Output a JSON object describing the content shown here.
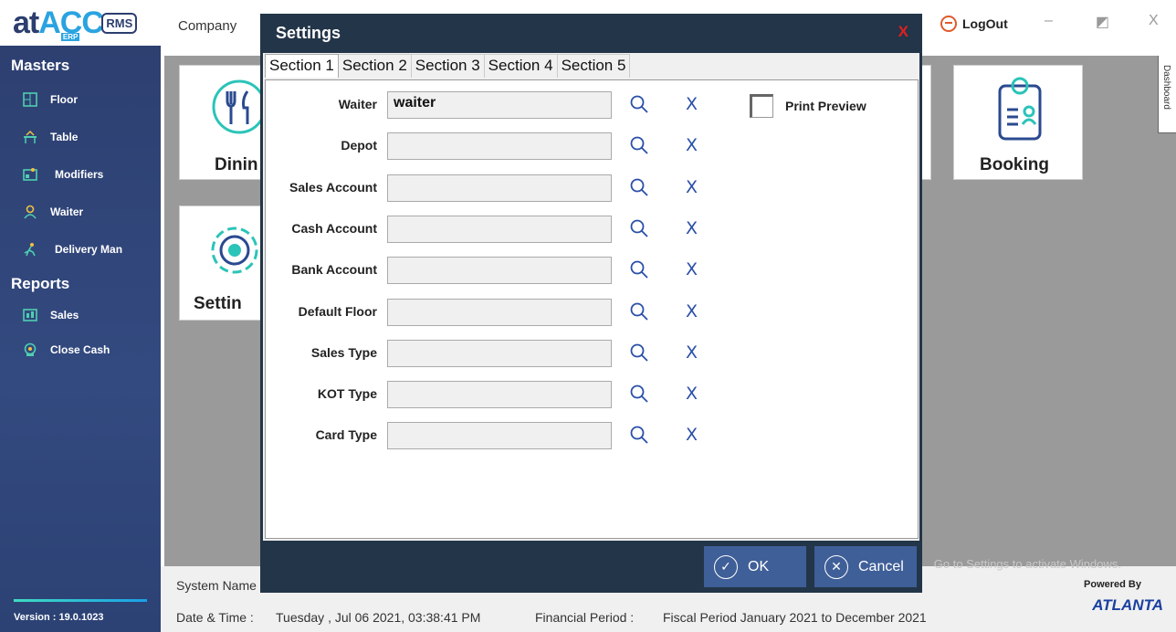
{
  "sidebar": {
    "masters_title": "Masters",
    "masters_items": [
      {
        "label": "Floor",
        "icon": "floor-icon"
      },
      {
        "label": "Table",
        "icon": "table-icon"
      },
      {
        "label": "Modifiers",
        "icon": "modifiers-icon"
      },
      {
        "label": "Waiter",
        "icon": "waiter-icon"
      },
      {
        "label": "Delivery Man",
        "icon": "delivery-man-icon"
      }
    ],
    "reports_title": "Reports",
    "reports_items": [
      {
        "label": "Sales",
        "icon": "sales-icon"
      },
      {
        "label": "Close Cash",
        "icon": "close-cash-icon"
      }
    ],
    "version": "Version :  19.0.1023"
  },
  "topbar": {
    "company": "Company",
    "logout": "LogOut",
    "minimize": "–",
    "maximize": "◩",
    "close": "X"
  },
  "tiles": {
    "dining": "Dinin",
    "setting": "Settin",
    "booking": "Booking",
    "dashboard_tab": "Dashboard"
  },
  "footer": {
    "system_name": "System Name :",
    "datetime_label": "Date & Time :",
    "datetime_value": "Tuesday , Jul 06 2021, 03:38:41 PM",
    "financial_label": "Financial Period :",
    "financial_value": "Fiscal Period January 2021 to December 2021",
    "powered_by": "Powered By",
    "atlanta": "ATLANTA",
    "watermark": "Go to Settings to activate Windows."
  },
  "modal": {
    "title": "Settings",
    "close": "X",
    "tabs": [
      "Section 1",
      "Section 2",
      "Section 3",
      "Section 4",
      "Section 5"
    ],
    "fields": [
      {
        "label": "Waiter",
        "value": "waiter"
      },
      {
        "label": "Depot",
        "value": ""
      },
      {
        "label": "Sales Account",
        "value": ""
      },
      {
        "label": "Cash Account",
        "value": ""
      },
      {
        "label": "Bank Account",
        "value": ""
      },
      {
        "label": "Default Floor",
        "value": ""
      },
      {
        "label": "Sales Type",
        "value": ""
      },
      {
        "label": "KOT Type",
        "value": ""
      },
      {
        "label": "Card Type",
        "value": ""
      }
    ],
    "clear_glyph": "X",
    "print_preview_label": "Print Preview",
    "print_preview_checked": false,
    "ok_label": "OK",
    "cancel_label": "Cancel"
  },
  "colors": {
    "sidebar": "#2c3e6e",
    "modal_header": "#233548",
    "button": "#3f5f98",
    "close_red": "#e02020",
    "clear_blue": "#2a4fa8"
  }
}
